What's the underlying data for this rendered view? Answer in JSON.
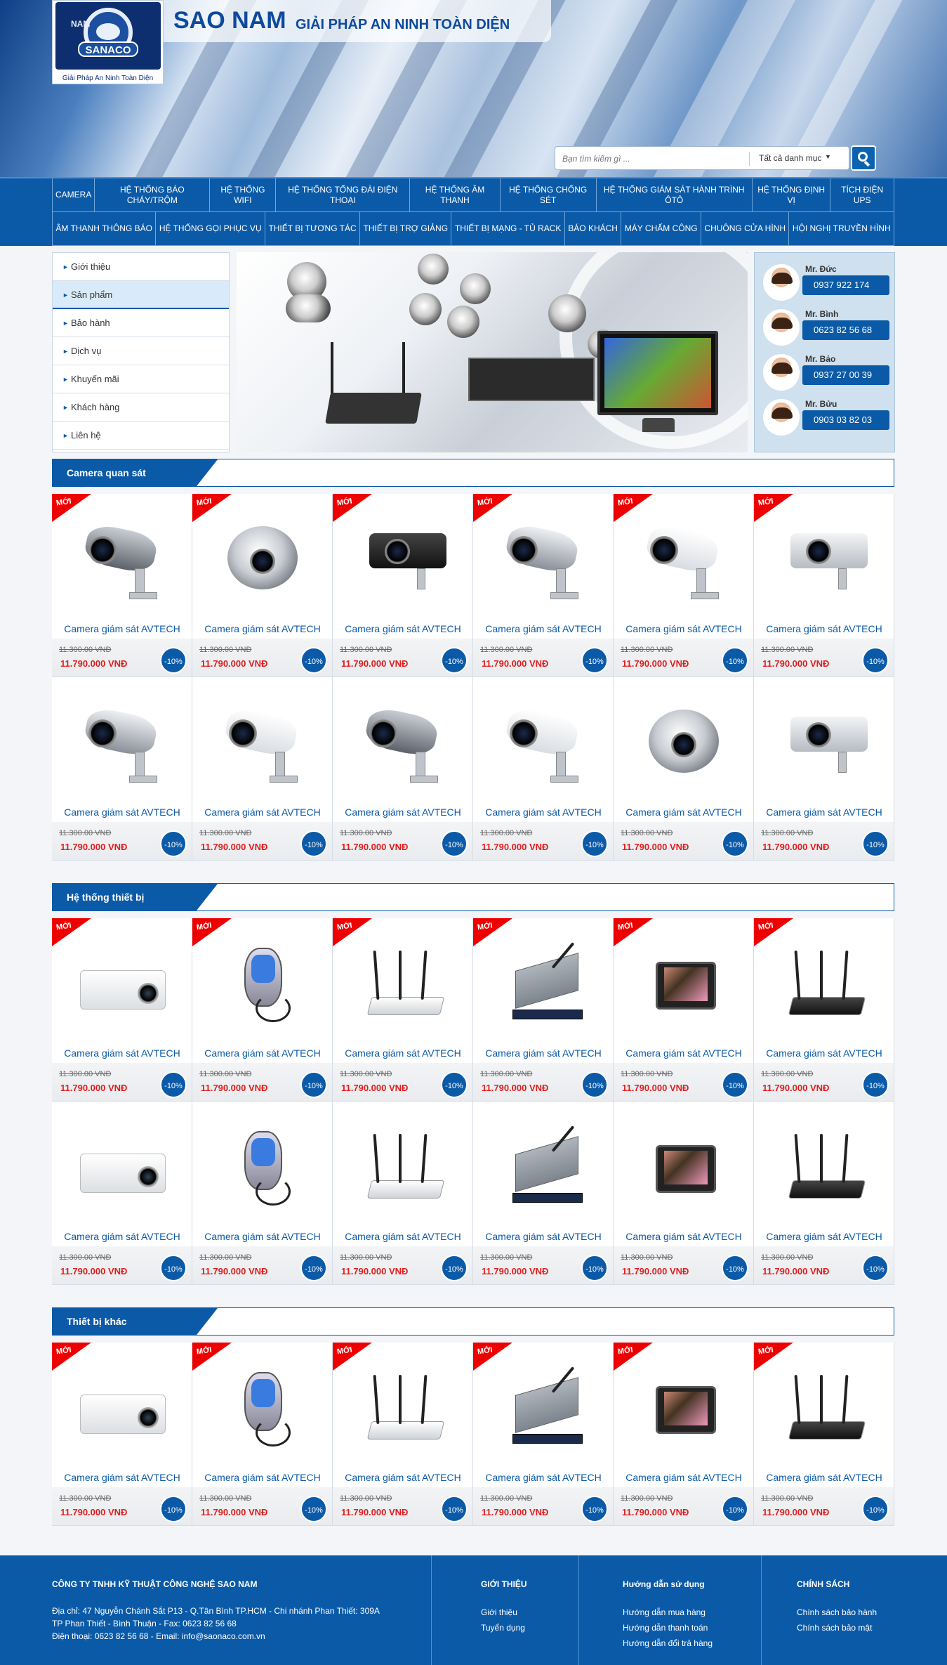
{
  "brand": {
    "name": "SAO NAM",
    "tagline": "GIẢI PHÁP AN NINH TOÀN DIỆN",
    "logo_text": "SANACO",
    "logo_sub": "Giải Pháp An Ninh Toàn Diện",
    "logo_nam": "NAM"
  },
  "search": {
    "placeholder": "Bạn tìm kiếm gì ...",
    "category": "Tất cả danh mục",
    "caret": "▼"
  },
  "nav": {
    "row1": [
      "CAMERA",
      "HỆ THỐNG BÁO CHÁY/TRỘM",
      "HỆ THỐNG WIFI",
      "HỆ THỐNG TỔNG ĐÀI ĐIỆN THOẠI",
      "HỆ THỐNG ÂM THANH",
      "HỆ THỐNG CHỐNG SÉT",
      "HỆ THỐNG GIÁM SÁT HÀNH TRÌNH ÔTÔ",
      "HỆ THỐNG ĐỊNH VỊ",
      "TÍCH ĐIỆN UPS"
    ],
    "row2": [
      "ÂM THANH THÔNG BÁO",
      "HỆ THỐNG GỌI PHỤC VỤ",
      "THIẾT BỊ TƯƠNG TÁC",
      "THIẾT BỊ TRỢ GIẢNG",
      "THIẾT BỊ MẠNG - TỦ RACK",
      "BÁO KHÁCH",
      "MÁY CHẤM CÔNG",
      "CHUÔNG CỬA HÌNH",
      "HỘI NGHỊ TRUYỀN HÌNH"
    ]
  },
  "sidemenu": [
    "Giới thiệu",
    "Sản phẩm",
    "Bảo hành",
    "Dịch vụ",
    "Khuyến mãi",
    "Khách hàng",
    "Liên hệ"
  ],
  "sidemenu_active": 1,
  "contacts": [
    {
      "name": "Mr. Đức",
      "phone": "0937 922 174"
    },
    {
      "name": "Mr. Bình",
      "phone": "0623 82 56 68"
    },
    {
      "name": "Mr. Bảo",
      "phone": "0937 27 00 39"
    },
    {
      "name": "Mr. Bửu",
      "phone": "0903 03 82 03"
    }
  ],
  "product": {
    "badge": "MỚI",
    "title": "Camera giám sát AVTECH",
    "old_price": "11.300.00 VNĐ",
    "new_price": "11.790.000 VNĐ",
    "discount": "-10%"
  },
  "sections": [
    {
      "title": "Camera quan sát",
      "rows": [
        [
          "cam-bullet",
          "dome-white",
          "cam-box",
          "cam-bullet-gray",
          "cam-bullet-white",
          "cam-box-gray"
        ],
        [
          "cam-bullet-gray",
          "cam-bullet-white",
          "cam-bullet",
          "cam-bullet-white",
          "dome-white",
          "cam-box-gray"
        ]
      ],
      "badges": [
        [
          true,
          true,
          true,
          true,
          true,
          true
        ],
        [
          false,
          false,
          false,
          false,
          false,
          false
        ]
      ]
    },
    {
      "title": "Hệ thống thiết bị",
      "rows": [
        [
          "projector",
          "remote",
          "router-white",
          "switch",
          "tablet",
          "router-black"
        ],
        [
          "projector",
          "remote",
          "router-white",
          "switch",
          "tablet",
          "router-black"
        ]
      ],
      "badges": [
        [
          true,
          true,
          true,
          true,
          true,
          true
        ],
        [
          false,
          false,
          false,
          false,
          false,
          false
        ]
      ]
    },
    {
      "title": "Thiết bị khác",
      "rows": [
        [
          "projector",
          "remote",
          "router-white",
          "switch",
          "tablet",
          "router-black"
        ]
      ],
      "badges": [
        [
          true,
          true,
          true,
          true,
          true,
          true
        ]
      ]
    }
  ],
  "footer": {
    "company": "CÔNG TY TNHH KỸ THUẬT CÔNG NGHỆ SAO NAM",
    "address_lines": [
      "Địa chỉ: 47 Nguyễn Chánh Sắt P13 - Q.Tân Bình TP.HCM - Chi nhánh Phan Thiết: 309A",
      "TP Phan Thiết - Bình Thuận - Fax: 0623 82 56 68",
      "Điện thoại: 0623 82 56 68   -   Email: info@saonaco.com.vn"
    ],
    "col2": {
      "title": "GIỚI THIỆU",
      "links": [
        "Giới thiệu",
        "Tuyển dụng"
      ]
    },
    "col3": {
      "title": "Hướng dẫn sử dụng",
      "links": [
        "Hướng dẫn mua hàng",
        "Hướng dẫn thanh toán",
        "Hướng dẫn đổi trả hàng"
      ]
    },
    "col4": {
      "title": "CHÍNH SÁCH",
      "links": [
        "Chính sách bảo hành",
        "Chính sách bảo mật"
      ]
    }
  }
}
